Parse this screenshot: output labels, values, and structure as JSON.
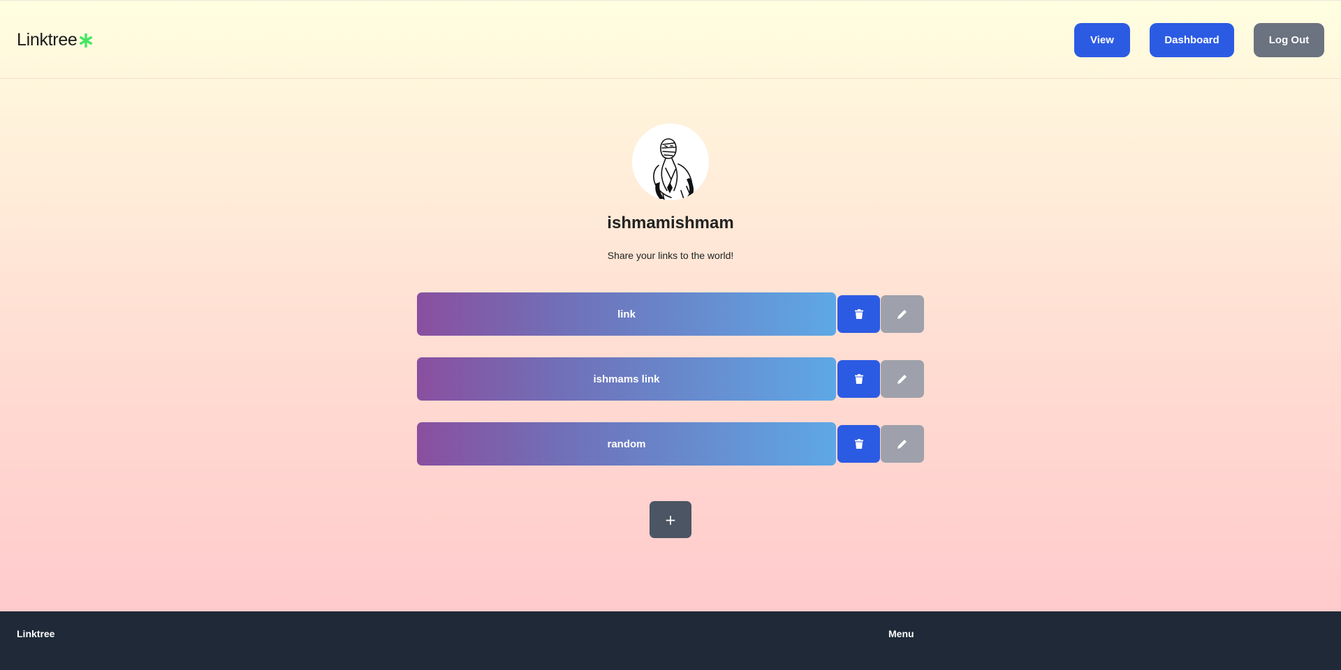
{
  "header": {
    "brand": "Linktree",
    "buttons": {
      "view": "View",
      "dashboard": "Dashboard",
      "logout": "Log Out"
    }
  },
  "profile": {
    "username": "ishmamishmam",
    "bio": "Share your links to the world!"
  },
  "links": [
    {
      "title": "link"
    },
    {
      "title": "ishmams link"
    },
    {
      "title": "random"
    }
  ],
  "add_button": "+",
  "footer": {
    "brand": "Linktree",
    "menu": "Menu"
  },
  "colors": {
    "primary": "#2c5be3",
    "secondary": "#6b7280",
    "brand_star": "#43e660",
    "footer_bg": "#1f2937"
  }
}
